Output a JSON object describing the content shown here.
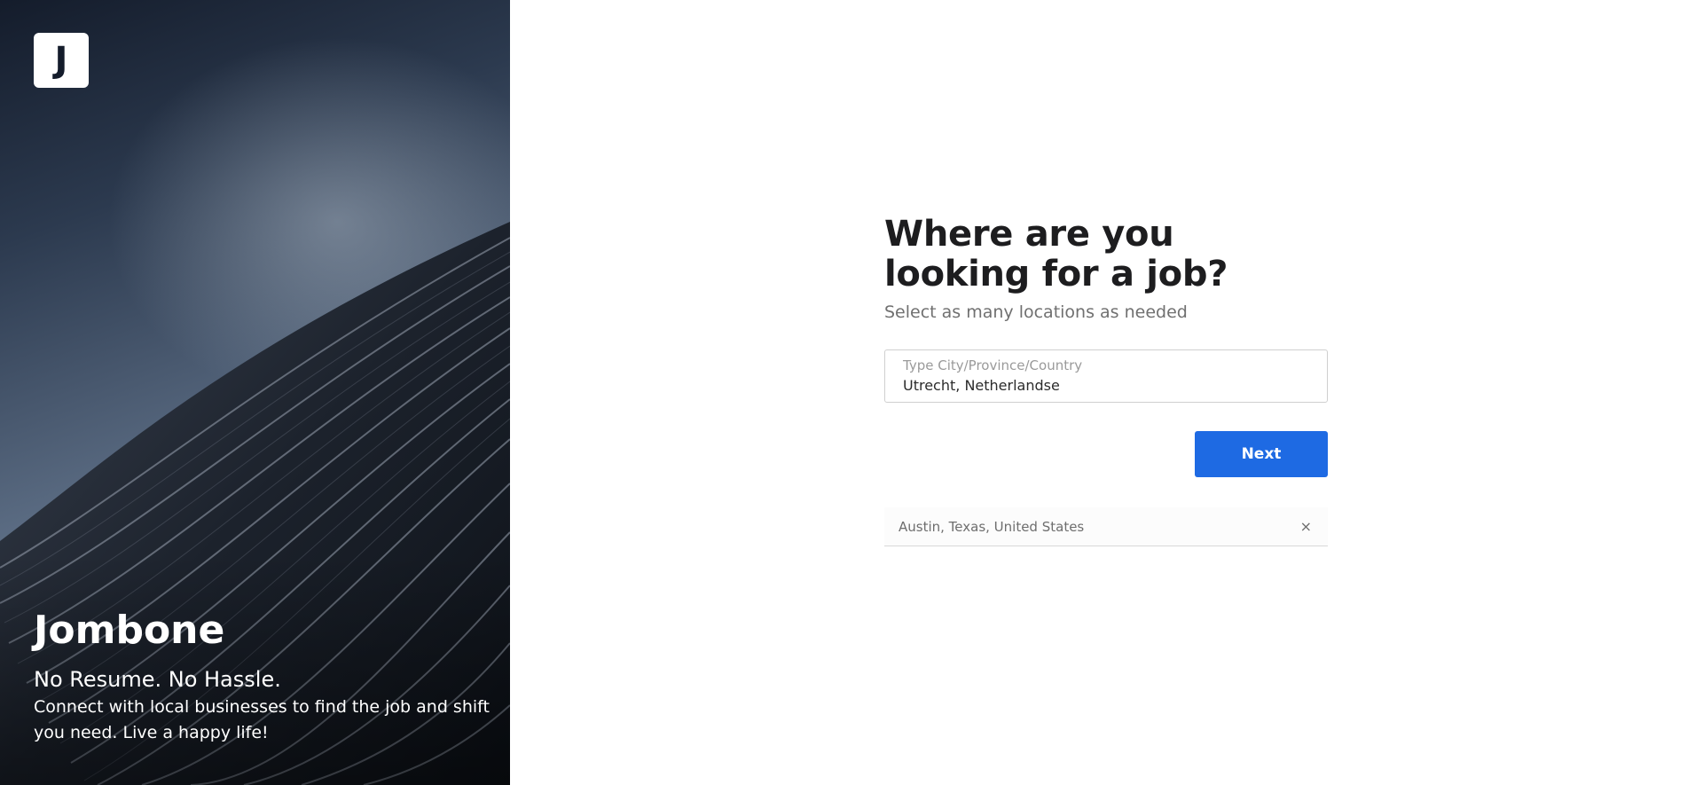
{
  "hero": {
    "logo_letter": "J",
    "brand": "Jombone",
    "tagline": "No Resume. No Hassle.",
    "description": "Connect with local businesses to find the job and shift you need. Live a happy life!"
  },
  "form": {
    "heading": "Where are you looking for a job?",
    "subheading": "Select as many locations as needed",
    "location_field": {
      "label": "Type City/Province/Country",
      "value": "Utrecht, Netherlandse"
    },
    "next_label": "Next",
    "selected_locations": [
      {
        "label": "Austin, Texas, United States",
        "remove_icon": "×"
      }
    ]
  },
  "colors": {
    "primary_button": "#1e6ae3",
    "heading_text": "#1d1d1f",
    "muted_text": "#707070"
  },
  "icons": {
    "remove": "close-icon"
  }
}
